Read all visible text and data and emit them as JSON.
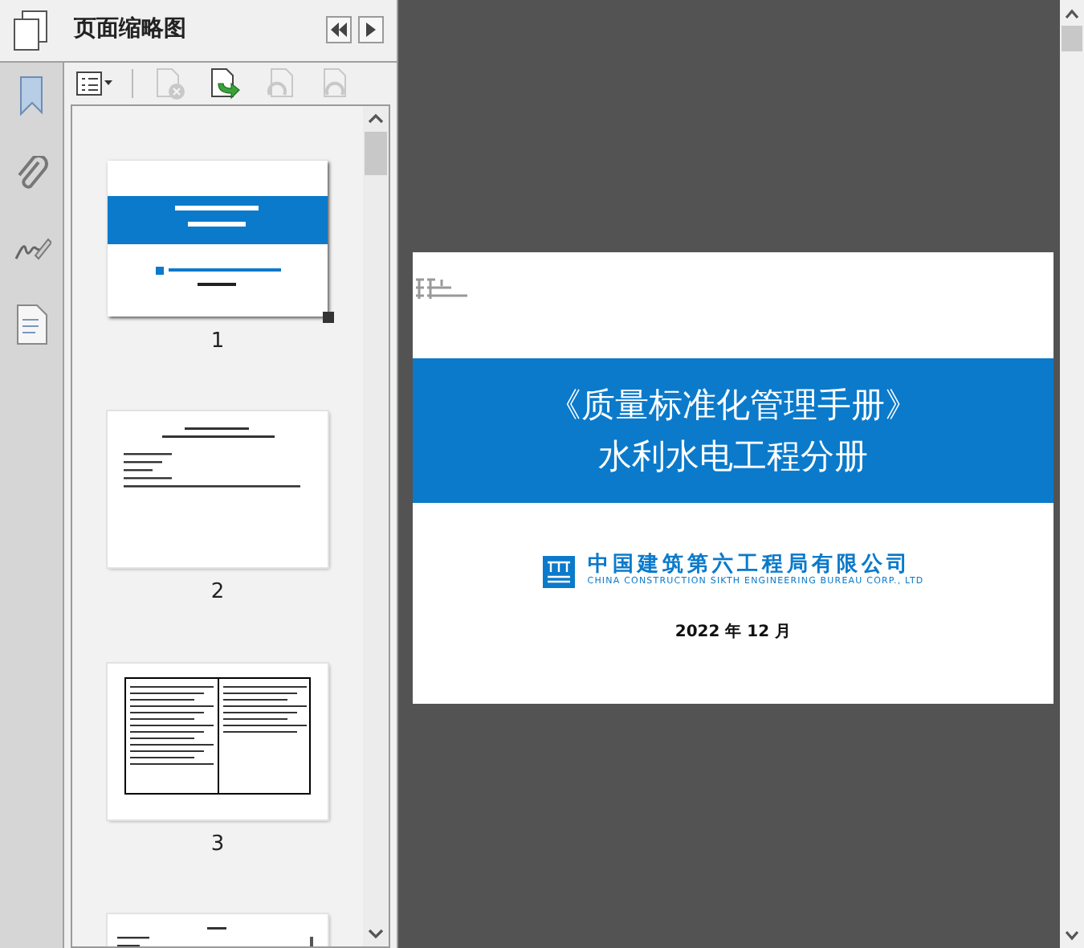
{
  "panel": {
    "title": "页面缩略图"
  },
  "toolbar": [
    {
      "kind": "options",
      "disabled": false
    },
    {
      "kind": "delete",
      "disabled": true
    },
    {
      "kind": "insert",
      "disabled": false
    },
    {
      "kind": "rotate-left",
      "disabled": true
    },
    {
      "kind": "rotate-right",
      "disabled": true
    }
  ],
  "thumbnails": [
    {
      "kind": "cover",
      "label": "1",
      "selected": true
    },
    {
      "kind": "text",
      "label": "2",
      "selected": false
    },
    {
      "kind": "table",
      "label": "3",
      "selected": false
    },
    {
      "kind": "contents",
      "selected": false
    }
  ],
  "page": {
    "title_lines": [
      "《质量标准化管理手册》",
      "水利水电工程分册"
    ],
    "company_name": "中国建筑第六工程局有限公司",
    "company_name_en": "CHINA CONSTRUCTION SIKTH ENGINEERING BUREAU CORP., LTD",
    "date": "2022 年 12 月"
  }
}
